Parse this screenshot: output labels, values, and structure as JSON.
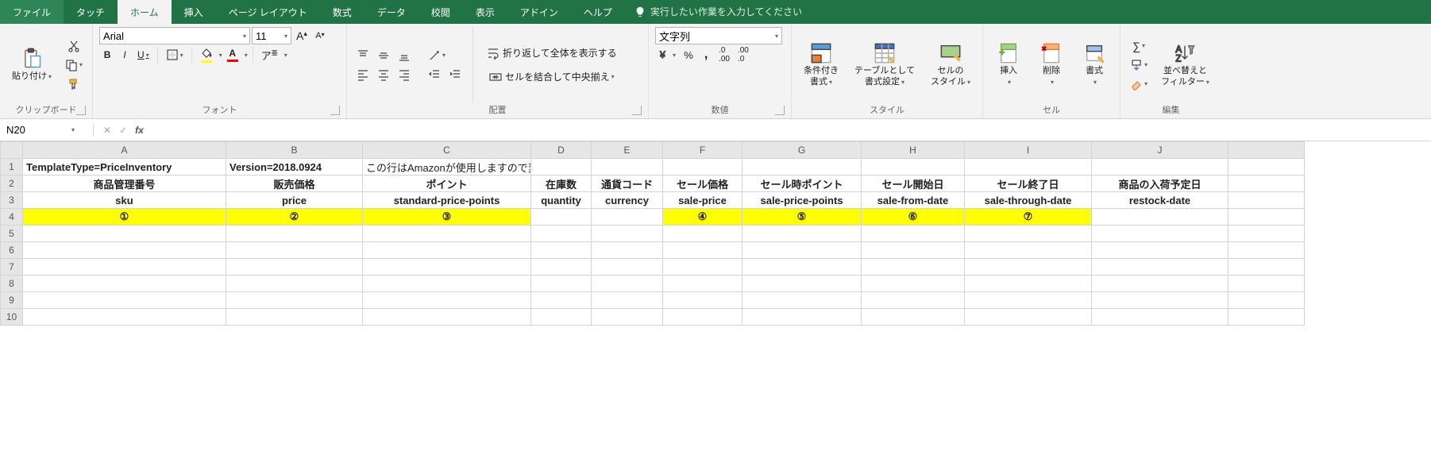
{
  "tabs": {
    "file": "ファイル",
    "touch": "タッチ",
    "home": "ホーム",
    "insert": "挿入",
    "pagelayout": "ページ レイアウト",
    "formulas": "数式",
    "data": "データ",
    "review": "校閲",
    "view": "表示",
    "addins": "アドイン",
    "help": "ヘルプ"
  },
  "tellme_placeholder": "実行したい作業を入力してください",
  "ribbon": {
    "clipboard": {
      "label": "クリップボード",
      "paste": "貼り付け"
    },
    "font": {
      "label": "フォント",
      "name": "Arial",
      "size": "11",
      "bold": "B",
      "italic": "I",
      "underline": "U"
    },
    "alignment": {
      "label": "配置",
      "wrap": "折り返して全体を表示する",
      "merge": "セルを結合して中央揃え"
    },
    "number": {
      "label": "数値",
      "format": "文字列"
    },
    "styles": {
      "label": "スタイル",
      "condfmt": "条件付き\n書式",
      "table": "テーブルとして\n書式設定",
      "cell": "セルの\nスタイル"
    },
    "cells": {
      "label": "セル",
      "insert": "挿入",
      "delete": "削除",
      "format": "書式"
    },
    "editing": {
      "label": "編集",
      "sortfilter": "並べ替えと\nフィルター"
    }
  },
  "nameBox": "N20",
  "formula": "",
  "columns": [
    "A",
    "B",
    "C",
    "D",
    "E",
    "F",
    "G",
    "H",
    "I",
    "J"
  ],
  "colClasses": [
    "cA",
    "cB",
    "cC",
    "cD",
    "cE",
    "cF",
    "cG",
    "cH",
    "cI",
    "cJ"
  ],
  "rows": 10,
  "cells": {
    "A1": "TemplateType=PriceInventory",
    "B1": "Version=2018.0924",
    "C1": "この行はAmazonが使用しますので変更や削除しないでください。",
    "A2": "商品管理番号",
    "B2": "販売価格",
    "C2": "ポイント",
    "D2": "在庫数",
    "E2": "通貨コード",
    "F2": "セール価格",
    "G2": "セール時ポイント",
    "H2": "セール開始日",
    "I2": "セール終了日",
    "J2": "商品の入荷予定日",
    "A3": "sku",
    "B3": "price",
    "C3": "standard-price-points",
    "D3": "quantity",
    "E3": "currency",
    "F3": "sale-price",
    "G3": "sale-price-points",
    "H3": "sale-from-date",
    "I3": "sale-through-date",
    "J3": "restock-date",
    "A4": "①",
    "B4": "②",
    "C4": "③",
    "F4": "④",
    "G4": "⑤",
    "H4": "⑥",
    "I4": "⑦"
  }
}
